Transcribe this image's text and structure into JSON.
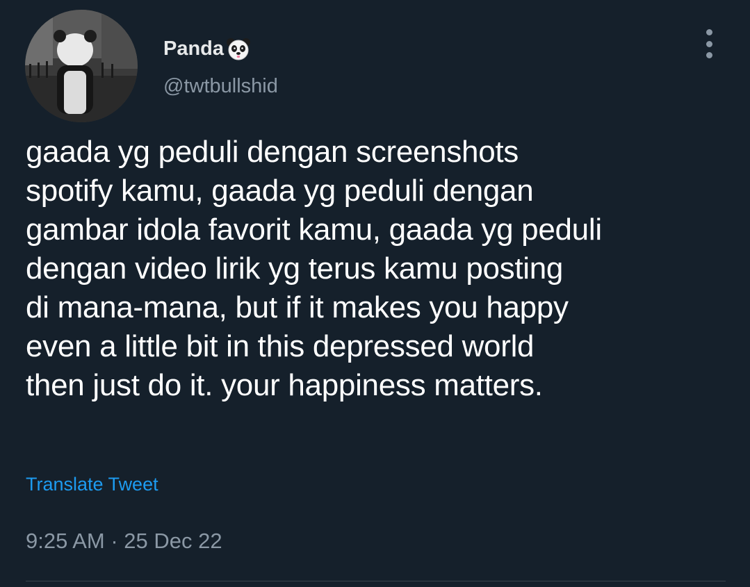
{
  "tweet": {
    "author": {
      "display_name": "Panda",
      "name_emoji": "panda-face-icon",
      "handle": "@twtbullshid",
      "avatar": "avatar-photo"
    },
    "more_icon": "more-vertical-icon",
    "text_lines": [
      "gaada yg peduli dengan screenshots",
      "spotify kamu, gaada yg peduli dengan",
      "gambar idola favorit kamu, gaada yg peduli",
      "dengan video lirik yg terus kamu posting",
      "di mana-mana, but if it makes you happy",
      "even a little bit in this depressed world",
      "then just do it. your happiness matters."
    ],
    "translate_label": "Translate Tweet",
    "timestamp": "9:25 AM · 25 Dec 22"
  },
  "colors": {
    "background": "#15202b",
    "primary_text": "#ffffff",
    "secondary_text": "#8b98a5",
    "link": "#1d9bf0",
    "divider": "#38444d"
  }
}
